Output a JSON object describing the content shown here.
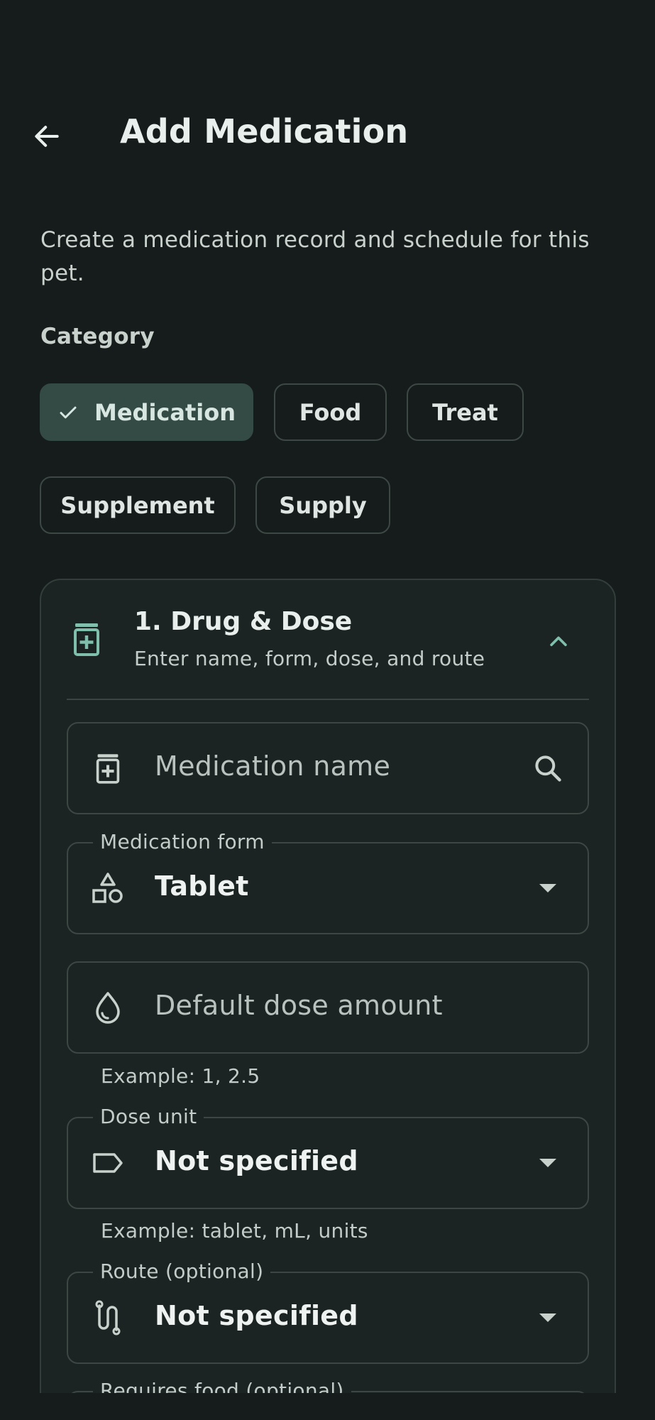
{
  "header": {
    "title": "Add Medication",
    "back_icon": "arrow-left-icon"
  },
  "intro_text": "Create a medication record and schedule for this pet.",
  "category": {
    "label": "Category",
    "chips": [
      {
        "label": "Medication",
        "selected": true
      },
      {
        "label": "Food",
        "selected": false
      },
      {
        "label": "Treat",
        "selected": false
      },
      {
        "label": "Supplement",
        "selected": false
      },
      {
        "label": "Supply",
        "selected": false
      }
    ]
  },
  "section": {
    "title": "1. Drug & Dose",
    "subtitle": "Enter name, form, dose, and route",
    "expanded": true,
    "fields": {
      "medication_name": {
        "placeholder": "Medication name"
      },
      "medication_form": {
        "label": "Medication form",
        "value": "Tablet"
      },
      "default_dose": {
        "placeholder": "Default dose amount",
        "helper": "Example: 1, 2.5"
      },
      "dose_unit": {
        "label": "Dose unit",
        "value": "Not specified",
        "helper": "Example: tablet, mL, units"
      },
      "route": {
        "label": "Route (optional)",
        "value": "Not specified"
      },
      "requires_food": {
        "label": "Requires food (optional)"
      }
    }
  },
  "colors": {
    "background": "#161c1b",
    "card": "#1b2422",
    "selected_chip": "#344a44",
    "accent_icon": "#7fbfab"
  }
}
